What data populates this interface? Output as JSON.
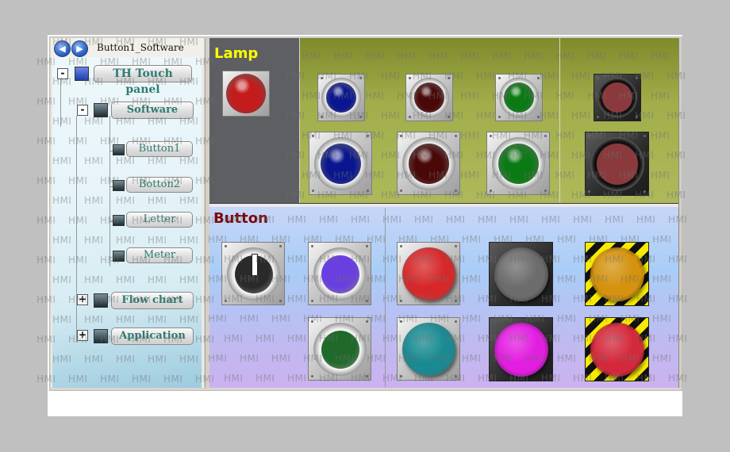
{
  "window": {
    "breadcrumb": "Button1_Software",
    "nav": {
      "back_icon": "arrow-left-icon",
      "forward_icon": "arrow-right-icon"
    }
  },
  "tree": {
    "root": {
      "label": "TH Touch panel",
      "expander": "-",
      "icon": "monitor-icon"
    },
    "software": {
      "label": "Software",
      "expander": "-",
      "icon": "network-node-icon"
    },
    "children": [
      {
        "label": "Button1",
        "icon": "node-icon"
      },
      {
        "label": "Botton2",
        "icon": "node-icon"
      },
      {
        "label": "Letter",
        "icon": "node-icon"
      },
      {
        "label": "Meter",
        "icon": "node-icon"
      }
    ],
    "flow_chart": {
      "label": "Flow chart",
      "expander": "+",
      "icon": "network-node-icon"
    },
    "application": {
      "label": "Application",
      "expander": "+",
      "icon": "network-node-icon"
    }
  },
  "watermark": "HMI",
  "lamp_section": {
    "title": "Lamp",
    "title_color": "#ffff00",
    "lamps": [
      {
        "name": "red-lamp",
        "color": "#c41c1c"
      },
      {
        "name": "blue-lamp-small",
        "color": "#0a1690"
      },
      {
        "name": "darkred-lamp-small",
        "color": "#4a0808"
      },
      {
        "name": "green-lamp-small",
        "color": "#0b7a14"
      },
      {
        "name": "maroon-lamp-small",
        "color": "#8a3a3c"
      },
      {
        "name": "blue-lamp-large",
        "color": "#0a1690"
      },
      {
        "name": "darkred-lamp-large",
        "color": "#4a0808"
      },
      {
        "name": "green-lamp-large",
        "color": "#0b7a14"
      },
      {
        "name": "maroon-lamp-large",
        "color": "#8a3a3c"
      }
    ]
  },
  "button_section": {
    "title": "Button",
    "title_color": "#7a0a0a",
    "buttons": [
      {
        "name": "selector-switch",
        "color": "#2a2a2a"
      },
      {
        "name": "purple-button",
        "color": "#6a3fe0"
      },
      {
        "name": "red-button",
        "color": "#d6282a"
      },
      {
        "name": "gray-button",
        "color": "#6c6c6c"
      },
      {
        "name": "orange-emergency-button",
        "color": "#d4920e"
      },
      {
        "name": "green-button",
        "color": "#1f6a2a"
      },
      {
        "name": "teal-button",
        "color": "#1a8a92"
      },
      {
        "name": "magenta-button",
        "color": "#e21ee0"
      },
      {
        "name": "red-emergency-button",
        "color": "#d4293c"
      }
    ]
  }
}
